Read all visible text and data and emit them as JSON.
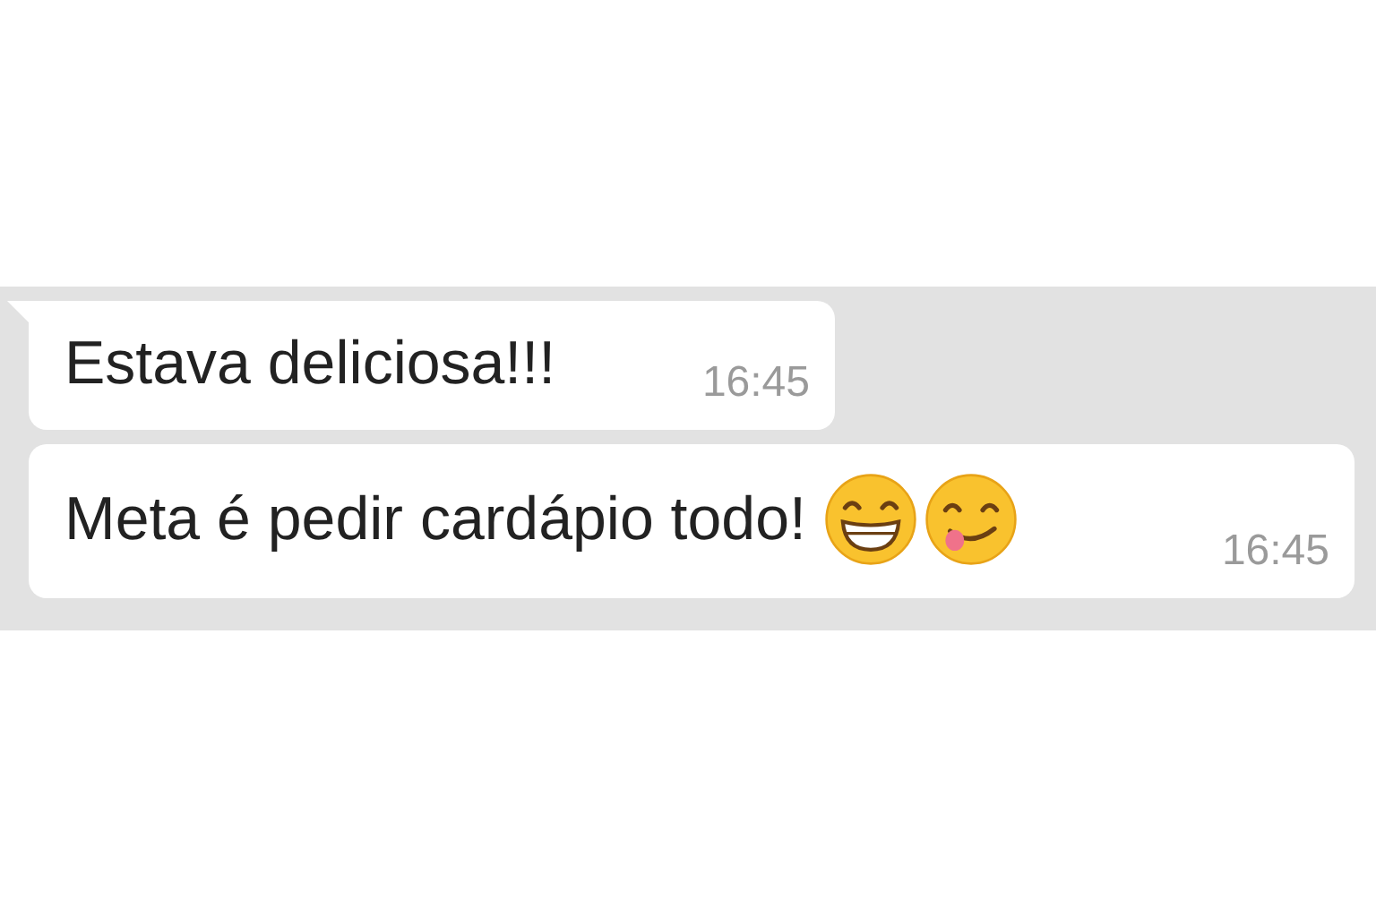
{
  "messages": [
    {
      "text": "Estava deliciosa!!!",
      "time": "16:45",
      "tail": true
    },
    {
      "text": "Meta é pedir cardápio todo!",
      "time": "16:45",
      "tail": false,
      "emojis": [
        {
          "kind": "grin"
        },
        {
          "kind": "yum"
        }
      ]
    }
  ]
}
